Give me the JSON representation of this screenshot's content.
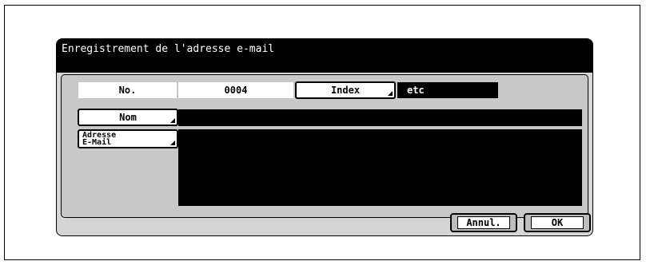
{
  "dialog": {
    "title": "Enregistrement de l'adresse e-mail"
  },
  "form": {
    "no_label": "No.",
    "no_value": "0004",
    "index_button": "Index",
    "index_value": "etc",
    "name_button": "Nom",
    "name_value": "",
    "email_button_line1": "Adresse",
    "email_button_line2": "E-Mail",
    "email_value": ""
  },
  "actions": {
    "cancel": "Annul.",
    "ok": "OK"
  },
  "colors": {
    "background": "#ffffff",
    "title_bar": "#000000",
    "panel": "#d6d6d6",
    "field": "#000000"
  }
}
